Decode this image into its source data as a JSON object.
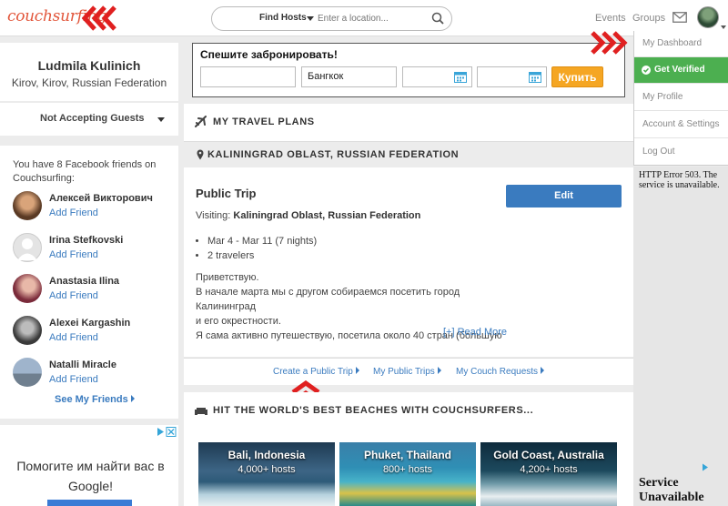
{
  "header": {
    "logo": "couchsurfing",
    "search_mode": "Find Hosts",
    "search_placeholder": "Enter a location...",
    "nav_events": "Events",
    "nav_groups": "Groups"
  },
  "profile": {
    "name": "Ludmila Kulinich",
    "location": "Kirov, Kirov, Russian Federation",
    "hosting_status": "Not Accepting Guests"
  },
  "friends": {
    "intro": "You have 8 Facebook friends on Couchsurfing:",
    "add_label": "Add Friend",
    "items": [
      {
        "name": "Алексей Викторович"
      },
      {
        "name": "Irina Stefkovski"
      },
      {
        "name": "Anastasia Ilina"
      },
      {
        "name": "Alexei Kargashin"
      },
      {
        "name": "Natalli Miracle"
      }
    ],
    "see_all": "See My Friends"
  },
  "left_ad": {
    "text": "Помогите им найти вас в Google!"
  },
  "booking": {
    "title": "Спешите забронировать!",
    "from_value": "",
    "to_value": "Бангкок",
    "buy_label": "Купить"
  },
  "travel": {
    "section_title": "MY TRAVEL PLANS",
    "location_header": "KALININGRAD OBLAST, RUSSIAN FEDERATION",
    "trip_title": "Public Trip",
    "edit_label": "Edit",
    "visiting_label": "Visiting:",
    "visiting_value": "Kaliningrad Oblast, Russian Federation",
    "dates": "Mar 4 - Mar 11 (7 nights)",
    "travelers": "2 travelers",
    "desc_line1": "Приветствую.",
    "desc_line2": "В начале марта мы с другом собираемся посетить город Калининград",
    "desc_line3": "и его окрестности.",
    "desc_line4": "Я сама активно путешествую, посетила около 40 стран (большую",
    "read_more": "[+] Read More"
  },
  "links": {
    "create_trip": "Create a Public Trip",
    "my_trips": "My Public Trips",
    "couch_requests": "My Couch Requests"
  },
  "beaches": {
    "section_title": "HIT THE WORLD'S BEST BEACHES WITH COUCHSURFERS...",
    "items": [
      {
        "name": "Bali, Indonesia",
        "hosts": "4,000+ hosts"
      },
      {
        "name": "Phuket, Thailand",
        "hosts": "800+ hosts"
      },
      {
        "name": "Gold Coast, Australia",
        "hosts": "4,200+ hosts"
      }
    ]
  },
  "dropdown": {
    "dashboard": "My Dashboard",
    "verified": "Get Verified",
    "profile": "My Profile",
    "settings": "Account & Settings",
    "logout": "Log Out"
  },
  "error_panel": {
    "small_text": "HTTP Error 503. The service is unavailable.",
    "big_text": "Service Unavailable"
  },
  "colors": {
    "brand": "#e2563b",
    "link": "#3a7bbf",
    "verified": "#4caf50",
    "buy": "#f5a623"
  }
}
